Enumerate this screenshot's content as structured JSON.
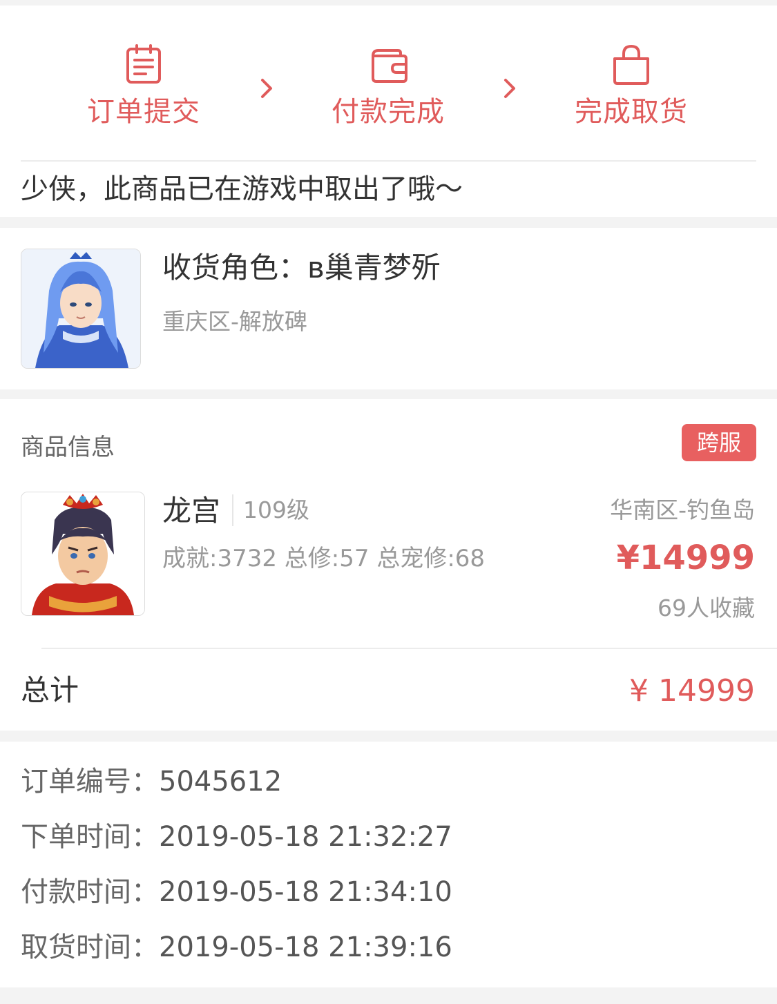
{
  "progress": {
    "steps": [
      {
        "label": "订单提交",
        "icon": "clipboard-icon"
      },
      {
        "label": "付款完成",
        "icon": "wallet-icon"
      },
      {
        "label": "完成取货",
        "icon": "shopping-bag-icon"
      }
    ],
    "accent_color": "#e05b5b"
  },
  "notice": "少侠，此商品已在游戏中取出了哦～",
  "receiver": {
    "role_label": "收货角色：",
    "role_name": "в巢青梦歽",
    "server": "重庆区-解放碑"
  },
  "goods": {
    "section_title": "商品信息",
    "badge": "跨服",
    "name": "龙宫",
    "level": "109级",
    "stats": "成就:3732 总修:57 总宠修:68",
    "server": "华南区-钓鱼岛",
    "price": "¥14999",
    "favorites": "69人收藏"
  },
  "total": {
    "label": "总计",
    "value": "¥ 14999"
  },
  "order_info": {
    "order_no_label": "订单编号：",
    "order_no": "5045612",
    "created_label": "下单时间：",
    "created": "2019-05-18 21:32:27",
    "paid_label": "付款时间：",
    "paid": "2019-05-18 21:34:10",
    "picked_label": "取货时间：",
    "picked": "2019-05-18 21:39:16"
  }
}
